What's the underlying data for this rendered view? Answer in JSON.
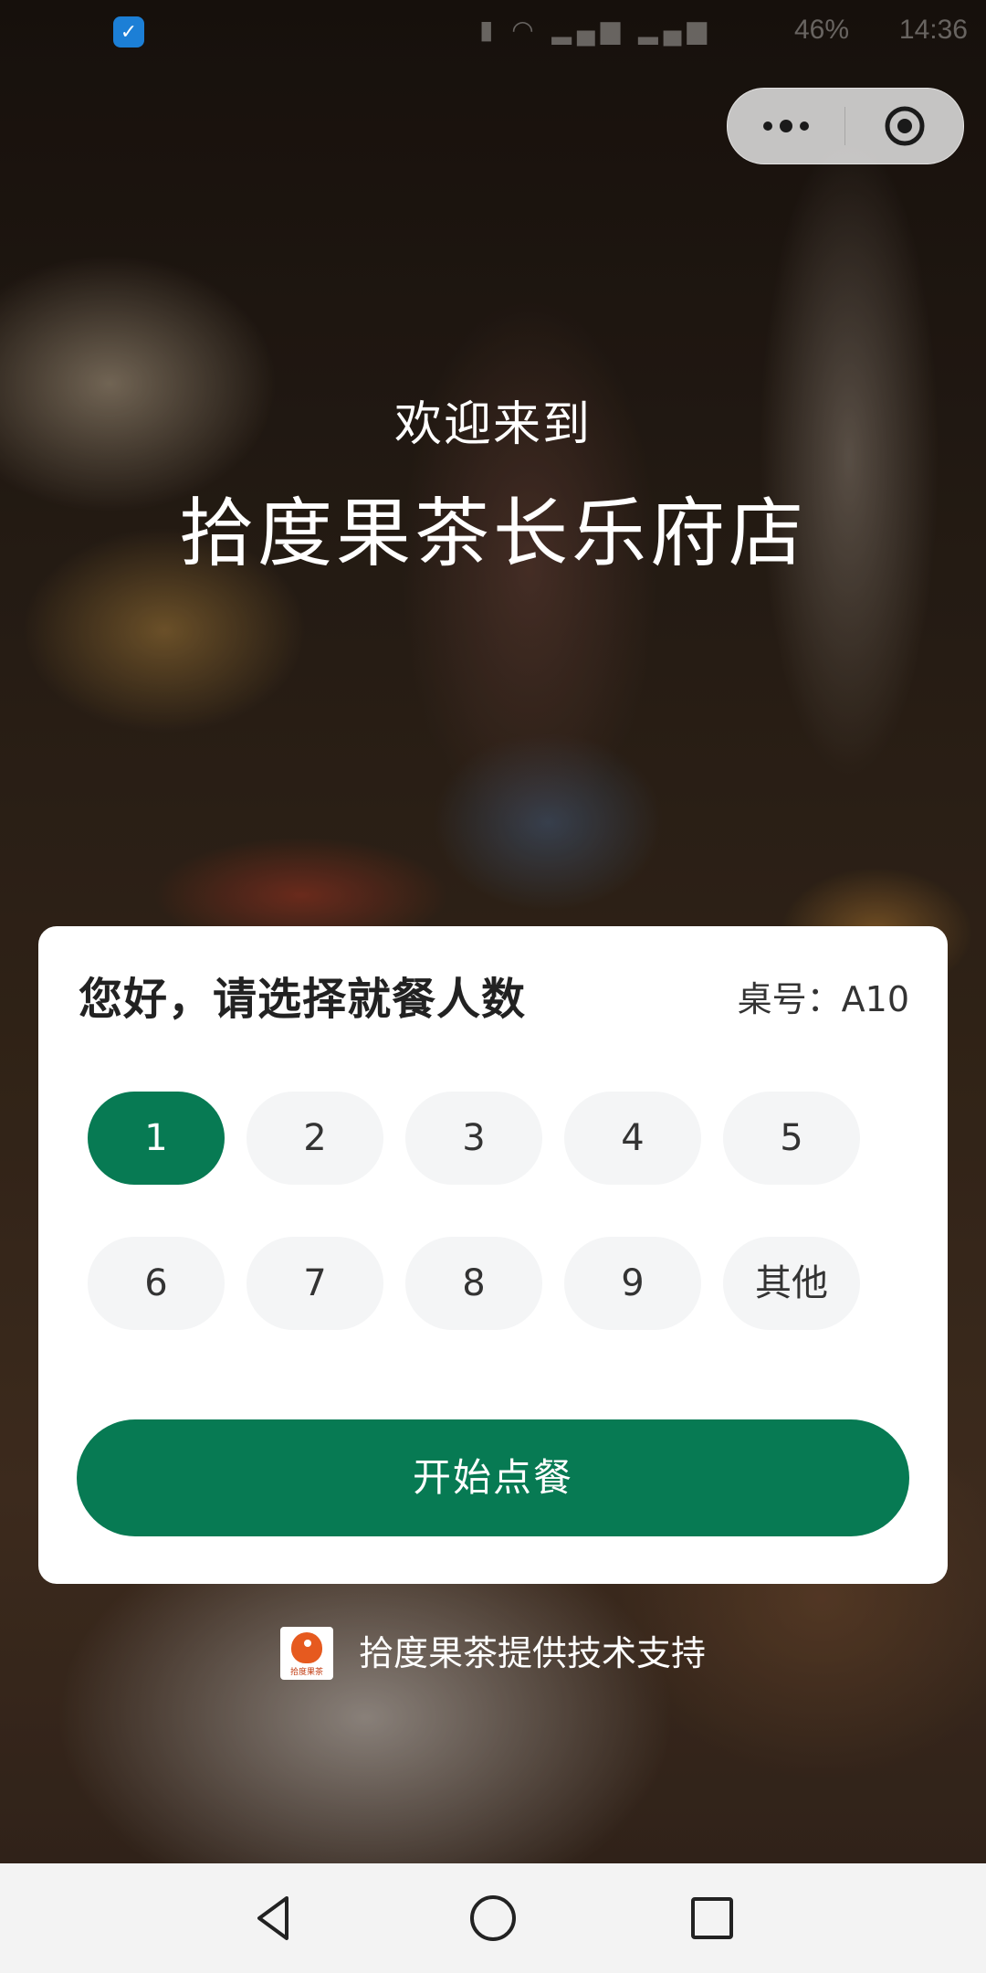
{
  "status_bar": {
    "battery": "46%",
    "time": "14:36",
    "icons": [
      "shield-icon",
      "signal-icon",
      "wifi-icon",
      "battery-icon"
    ]
  },
  "mini_program_capsule": {
    "icons": [
      "more-dots-icon",
      "close-target-icon"
    ]
  },
  "header": {
    "welcome": "欢迎来到",
    "store_name": "拾度果茶长乐府店"
  },
  "card": {
    "title": "您好，请选择就餐人数",
    "table_number": "桌号：A10",
    "options": [
      "1",
      "2",
      "3",
      "4",
      "5",
      "6",
      "7",
      "8",
      "9",
      "其他"
    ],
    "selected": "1",
    "start_button": "开始点餐"
  },
  "footer": {
    "support_text": "拾度果茶提供技术支持",
    "logo_text": "拾度果茶"
  },
  "nav_bar": {
    "icons": [
      "back-icon",
      "home-icon",
      "recents-icon"
    ]
  },
  "colors": {
    "accent": "#077a53",
    "pill_bg": "#f4f5f6",
    "card_bg": "#ffffff",
    "nav_bg": "#f3f3f3"
  }
}
